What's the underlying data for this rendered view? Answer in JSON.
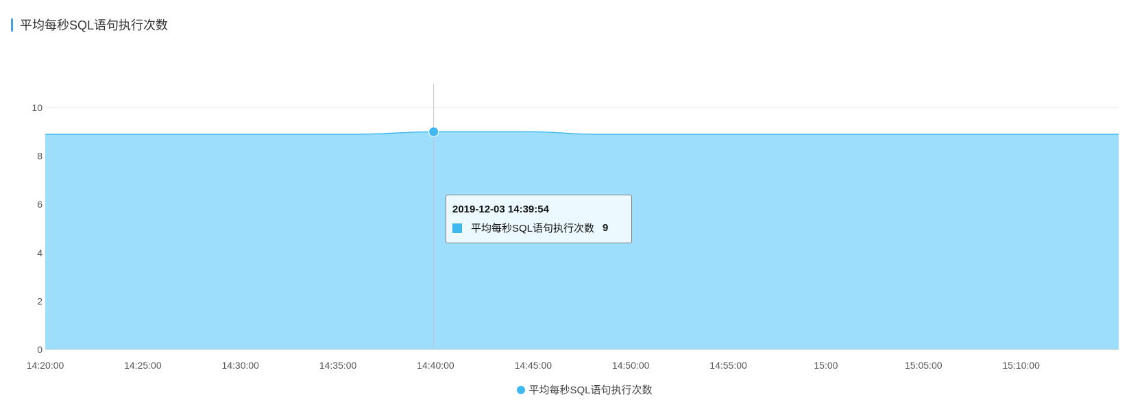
{
  "panel": {
    "title": "平均每秒SQL语句执行次数"
  },
  "chart_data": {
    "type": "area",
    "title": "平均每秒SQL语句执行次数",
    "xlabel": "",
    "ylabel": "",
    "ylim": [
      0,
      10
    ],
    "yticks": [
      "0",
      "2",
      "4",
      "6",
      "8",
      "10"
    ],
    "xticks": [
      "14:20:00",
      "14:25:00",
      "14:30:00",
      "14:35:00",
      "14:40:00",
      "14:45:00",
      "14:50:00",
      "14:55:00",
      "15:00",
      "15:05:00",
      "15:10:00"
    ],
    "xdomain": [
      "14:20:00",
      "15:15:00"
    ],
    "grid": true,
    "legend_position": "bottom-center",
    "series": [
      {
        "name": "平均每秒SQL语句执行次数",
        "color": "#3fb8f0",
        "fill": "#9cdefb",
        "x": [
          "14:20:00",
          "14:24:00",
          "14:28:00",
          "14:32:00",
          "14:36:00",
          "14:39:54",
          "14:42:00",
          "14:45:00",
          "14:48:00",
          "14:52:00",
          "14:56:00",
          "15:00:00",
          "15:04:00",
          "15:08:00",
          "15:12:00",
          "15:15:00"
        ],
        "values": [
          8.9,
          8.9,
          8.9,
          8.9,
          8.9,
          9.0,
          9.0,
          9.0,
          8.9,
          8.9,
          8.9,
          8.9,
          8.9,
          8.9,
          8.9,
          8.9
        ]
      }
    ],
    "tooltip": {
      "time": "2019-12-03 14:39:54",
      "series": "平均每秒SQL语句执行次数",
      "value": "9"
    }
  }
}
